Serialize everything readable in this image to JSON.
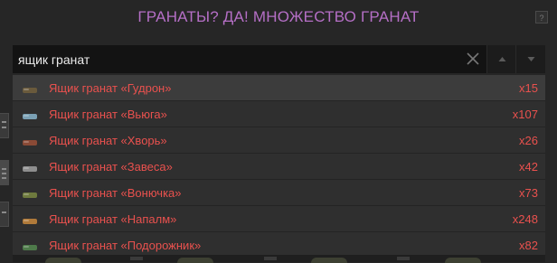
{
  "header": {
    "title": "ГРАНАТЫ? ДА! МНОЖЕСТВО ГРАНАТ",
    "help_label": "?"
  },
  "search": {
    "value": "ящик гранат",
    "icons": {
      "clear": "close-icon",
      "prev": "arrow-up-icon",
      "next": "arrow-down-icon"
    }
  },
  "results": [
    {
      "label": "Ящик гранат «Гудрон»",
      "qty": "x15",
      "thumb_color": "#6a5a3c",
      "selected": true
    },
    {
      "label": "Ящик гранат «Вьюга»",
      "qty": "x107",
      "thumb_color": "#7aa0b4"
    },
    {
      "label": "Ящик гранат «Хворь»",
      "qty": "x26",
      "thumb_color": "#8a4a36"
    },
    {
      "label": "Ящик гранат «Завеса»",
      "qty": "x42",
      "thumb_color": "#8e8e8e"
    },
    {
      "label": "Ящик гранат «Вонючка»",
      "qty": "x73",
      "thumb_color": "#6e7a3e"
    },
    {
      "label": "Ящик гранат «Напалм»",
      "qty": "x248",
      "thumb_color": "#b07a3a"
    },
    {
      "label": "Ящик гранат «Подорожник»",
      "qty": "x82",
      "thumb_color": "#4e7a4a"
    }
  ],
  "colors": {
    "accent_title": "#b56fc6",
    "item_text": "#e9514e",
    "background": "#262626"
  }
}
